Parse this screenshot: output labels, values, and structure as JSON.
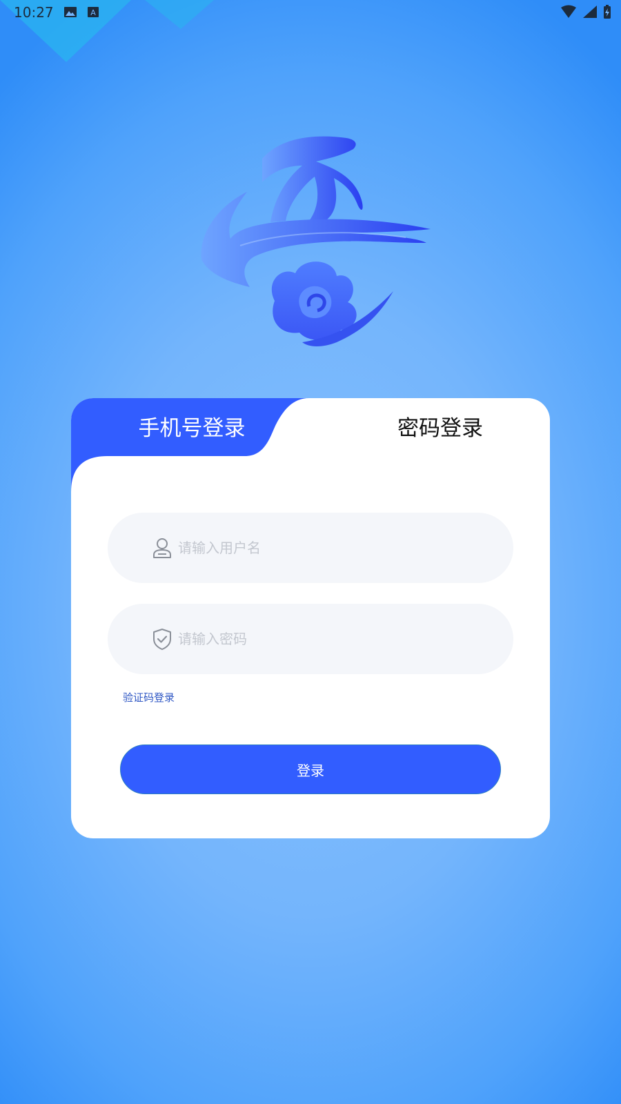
{
  "status_bar": {
    "time": "10:27",
    "left_icons": [
      "image-icon",
      "a-icon"
    ],
    "right_icons": [
      "wifi-icon",
      "signal-icon",
      "battery-charging-icon"
    ]
  },
  "colors": {
    "primary": "#325dff",
    "background": "#74b5fc",
    "field_bg": "#f4f6fa",
    "link": "#2f57c4"
  },
  "tabs": {
    "phone_login": "手机号登录",
    "password_login": "密码登录",
    "active": "password_login"
  },
  "form": {
    "username": {
      "value": "",
      "placeholder": "请输入用户名",
      "icon": "user-icon"
    },
    "password": {
      "value": "",
      "placeholder": "请输入密码",
      "icon": "shield-check-icon"
    },
    "sms_login_link": "验证码登录",
    "submit_label": "登录"
  }
}
